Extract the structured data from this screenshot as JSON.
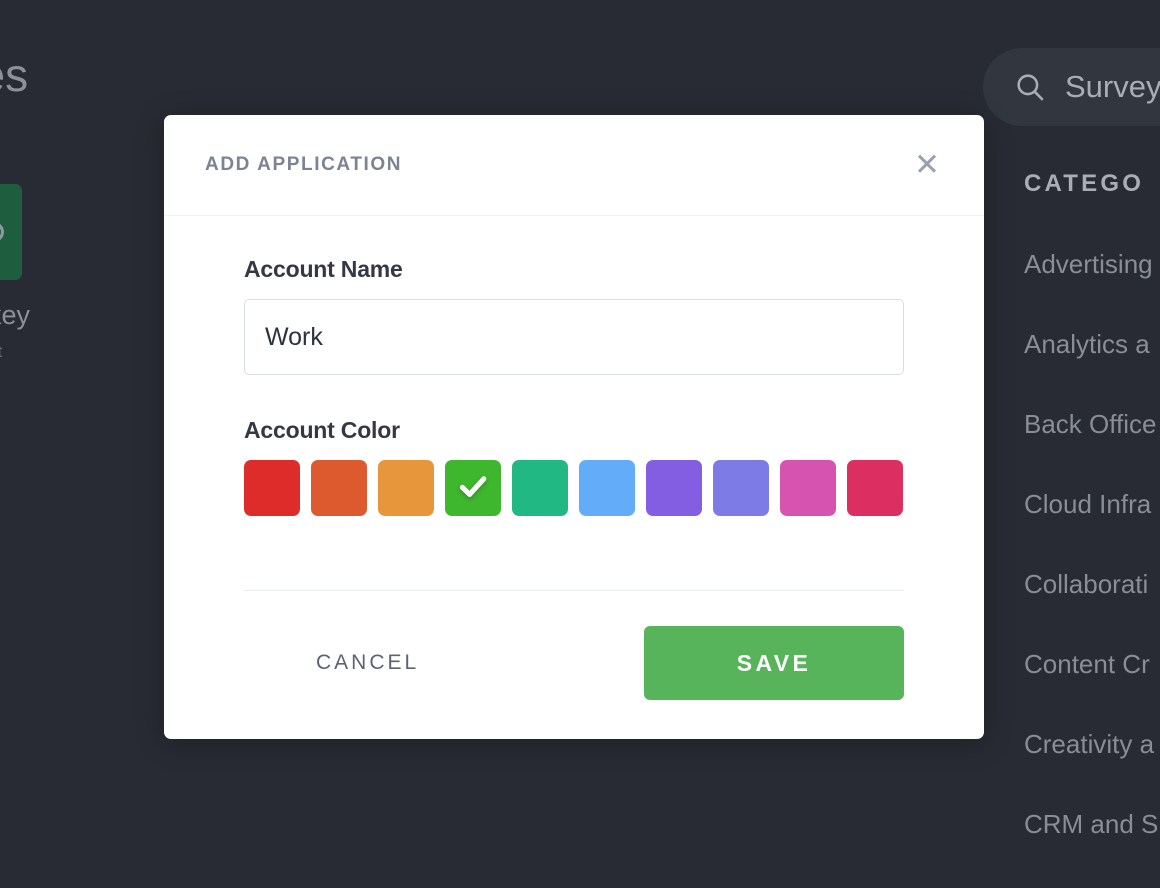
{
  "background": {
    "page_heading_fragment": "ries",
    "app_card": {
      "logo_icon": "surveymonkey-logo-icon",
      "title_fragment": "onkey",
      "subtitle_fragment": "upport",
      "card_color": "#1e5e3f"
    },
    "search": {
      "icon": "search-icon",
      "value": "Survey"
    },
    "categories_heading": "CATEGO",
    "categories": [
      "Advertising",
      "Analytics a",
      "Back Office",
      "Cloud Infra",
      "Collaborati",
      "Content Cr",
      "Creativity a",
      "CRM and S"
    ],
    "page_background_color": "#282b33"
  },
  "modal": {
    "title": "ADD APPLICATION",
    "close_icon": "close-icon",
    "account_name": {
      "label": "Account Name",
      "value": "Work",
      "placeholder": ""
    },
    "account_color": {
      "label": "Account Color",
      "selected_index": 3,
      "check_icon": "check-icon",
      "swatches": [
        {
          "name": "red",
          "hex": "#dd2c2a"
        },
        {
          "name": "orange-red",
          "hex": "#dc5a2d"
        },
        {
          "name": "orange",
          "hex": "#e8963c"
        },
        {
          "name": "green",
          "hex": "#3eb62e"
        },
        {
          "name": "teal",
          "hex": "#22b884"
        },
        {
          "name": "light-blue",
          "hex": "#63acfa"
        },
        {
          "name": "purple",
          "hex": "#835de2"
        },
        {
          "name": "indigo",
          "hex": "#7d7be6"
        },
        {
          "name": "pink",
          "hex": "#d653af"
        },
        {
          "name": "crimson",
          "hex": "#dc2e60"
        }
      ]
    },
    "footer": {
      "cancel_label": "CANCEL",
      "save_label": "SAVE",
      "save_color": "#57b45a"
    }
  }
}
